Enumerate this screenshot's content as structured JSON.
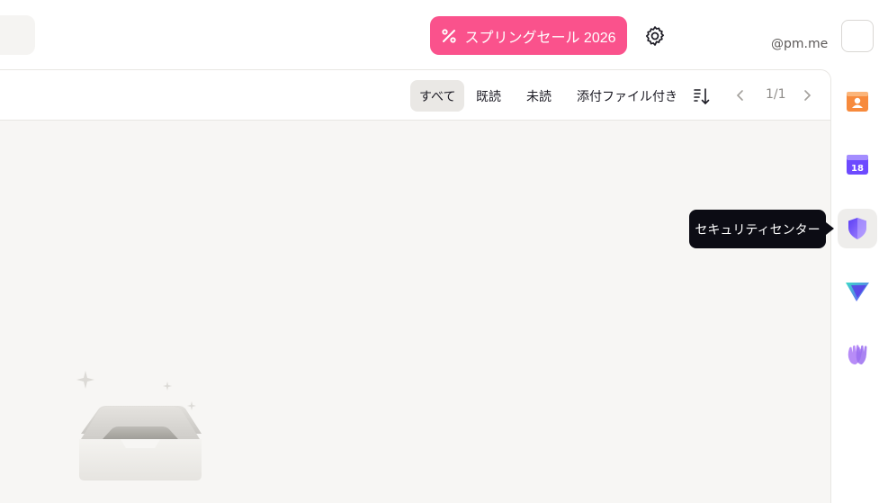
{
  "header": {
    "promo_label": "スプリングセール 2026",
    "account_email": "@pm.me"
  },
  "toolbar": {
    "filters": [
      {
        "label": "すべて",
        "active": true
      },
      {
        "label": "既読",
        "active": false
      },
      {
        "label": "未読",
        "active": false
      },
      {
        "label": "添付ファイル付き",
        "active": false
      }
    ],
    "pagination": "1/1"
  },
  "rail": {
    "apps": [
      {
        "icon": "contacts-icon",
        "color": "#f78a3c"
      },
      {
        "icon": "calendar-icon",
        "color": "#6d4aff",
        "badge": "18"
      },
      {
        "icon": "security-shield-icon",
        "color": "#8a6eff"
      },
      {
        "icon": "vpn-icon",
        "color": "#2ee0c4"
      },
      {
        "icon": "hand-wave-icon",
        "color": "#a67cf5"
      }
    ]
  },
  "tooltip": {
    "text": "セキュリティセンター"
  },
  "colors": {
    "promo": "#fa528c",
    "panel_bg": "#f7f6f4",
    "tooltip_bg": "#0c0c14"
  }
}
